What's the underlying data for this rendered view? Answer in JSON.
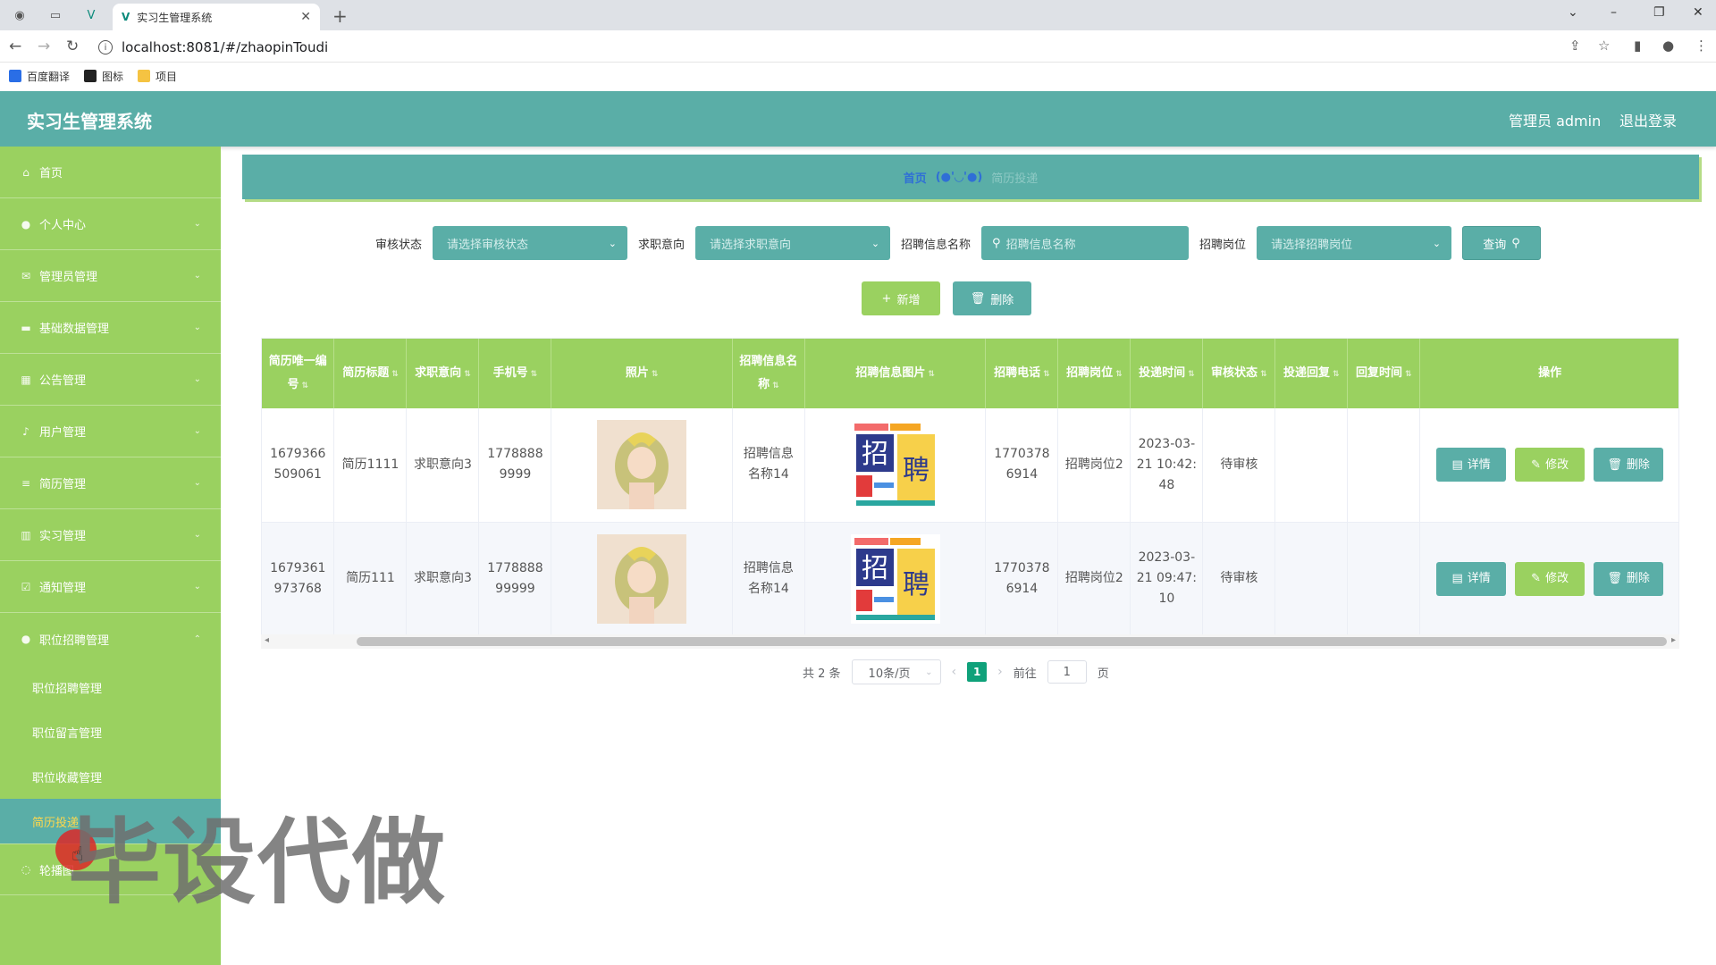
{
  "browser": {
    "tab_title": "实习生管理系统",
    "url": "localhost:8081/#/zhaopinToudi",
    "bookmarks": [
      {
        "label": "百度翻译",
        "color": "#2a6ee6"
      },
      {
        "label": "图标",
        "color": "#222222"
      },
      {
        "label": "项目",
        "color": "#f5c342"
      }
    ]
  },
  "header": {
    "title": "实习生管理系统",
    "admin": "管理员 admin",
    "logout": "退出登录"
  },
  "sidebar": {
    "items": [
      {
        "label": "首页",
        "icon": "home-icon"
      },
      {
        "label": "个人中心",
        "icon": "user-icon"
      },
      {
        "label": "管理员管理",
        "icon": "mail-icon"
      },
      {
        "label": "基础数据管理",
        "icon": "monitor-icon"
      },
      {
        "label": "公告管理",
        "icon": "calendar-icon"
      },
      {
        "label": "用户管理",
        "icon": "mic-icon"
      },
      {
        "label": "简历管理",
        "icon": "list-icon"
      },
      {
        "label": "实习管理",
        "icon": "chart-icon"
      },
      {
        "label": "通知管理",
        "icon": "check-icon"
      },
      {
        "label": "职位招聘管理",
        "icon": "person-icon"
      }
    ],
    "sub_items": [
      "职位招聘管理",
      "职位留言管理",
      "职位收藏管理",
      "简历投递"
    ],
    "last_item": "轮播图"
  },
  "breadcrumb": {
    "home": "首页",
    "emoticon": "(●'◡'●)",
    "current": "简历投递"
  },
  "filters": {
    "status_label": "审核状态",
    "status_placeholder": "请选择审核状态",
    "intent_label": "求职意向",
    "intent_placeholder": "请选择求职意向",
    "info_name_label": "招聘信息名称",
    "info_name_placeholder": "招聘信息名称",
    "position_label": "招聘岗位",
    "position_placeholder": "请选择招聘岗位",
    "query_button": "查询"
  },
  "actions": {
    "add": "新增",
    "delete": "删除"
  },
  "table": {
    "headers": [
      "简历唯一编号",
      "简历标题",
      "求职意向",
      "手机号",
      "照片",
      "招聘信息名称",
      "招聘信息图片",
      "招聘电话",
      "招聘岗位",
      "投递时间",
      "审核状态",
      "投递回复",
      "回复时间",
      "操作"
    ],
    "rows": [
      {
        "id": "1679366509061",
        "title": "简历1111",
        "intent": "求职意向3",
        "phone": "17788889999",
        "info_name": "招聘信息名称14",
        "recruit_phone": "17703786914",
        "position": "招聘岗位2",
        "time": "2023-03-21 10:42:48",
        "status": "待审核",
        "reply": "",
        "reply_time": ""
      },
      {
        "id": "1679361973768",
        "title": "简历111",
        "intent": "求职意向3",
        "phone": "177888899999",
        "info_name": "招聘信息名称14",
        "recruit_phone": "17703786914",
        "position": "招聘岗位2",
        "time": "2023-03-21 09:47:10",
        "status": "待审核",
        "reply": "",
        "reply_time": ""
      }
    ],
    "op_detail": "详情",
    "op_edit": "修改",
    "op_delete": "删除"
  },
  "pagination": {
    "total": "共 2 条",
    "page_size": "10条/页",
    "current_page": "1",
    "goto_label": "前往",
    "goto_value": "1",
    "page_suffix": "页"
  },
  "watermark": "毕设代做"
}
